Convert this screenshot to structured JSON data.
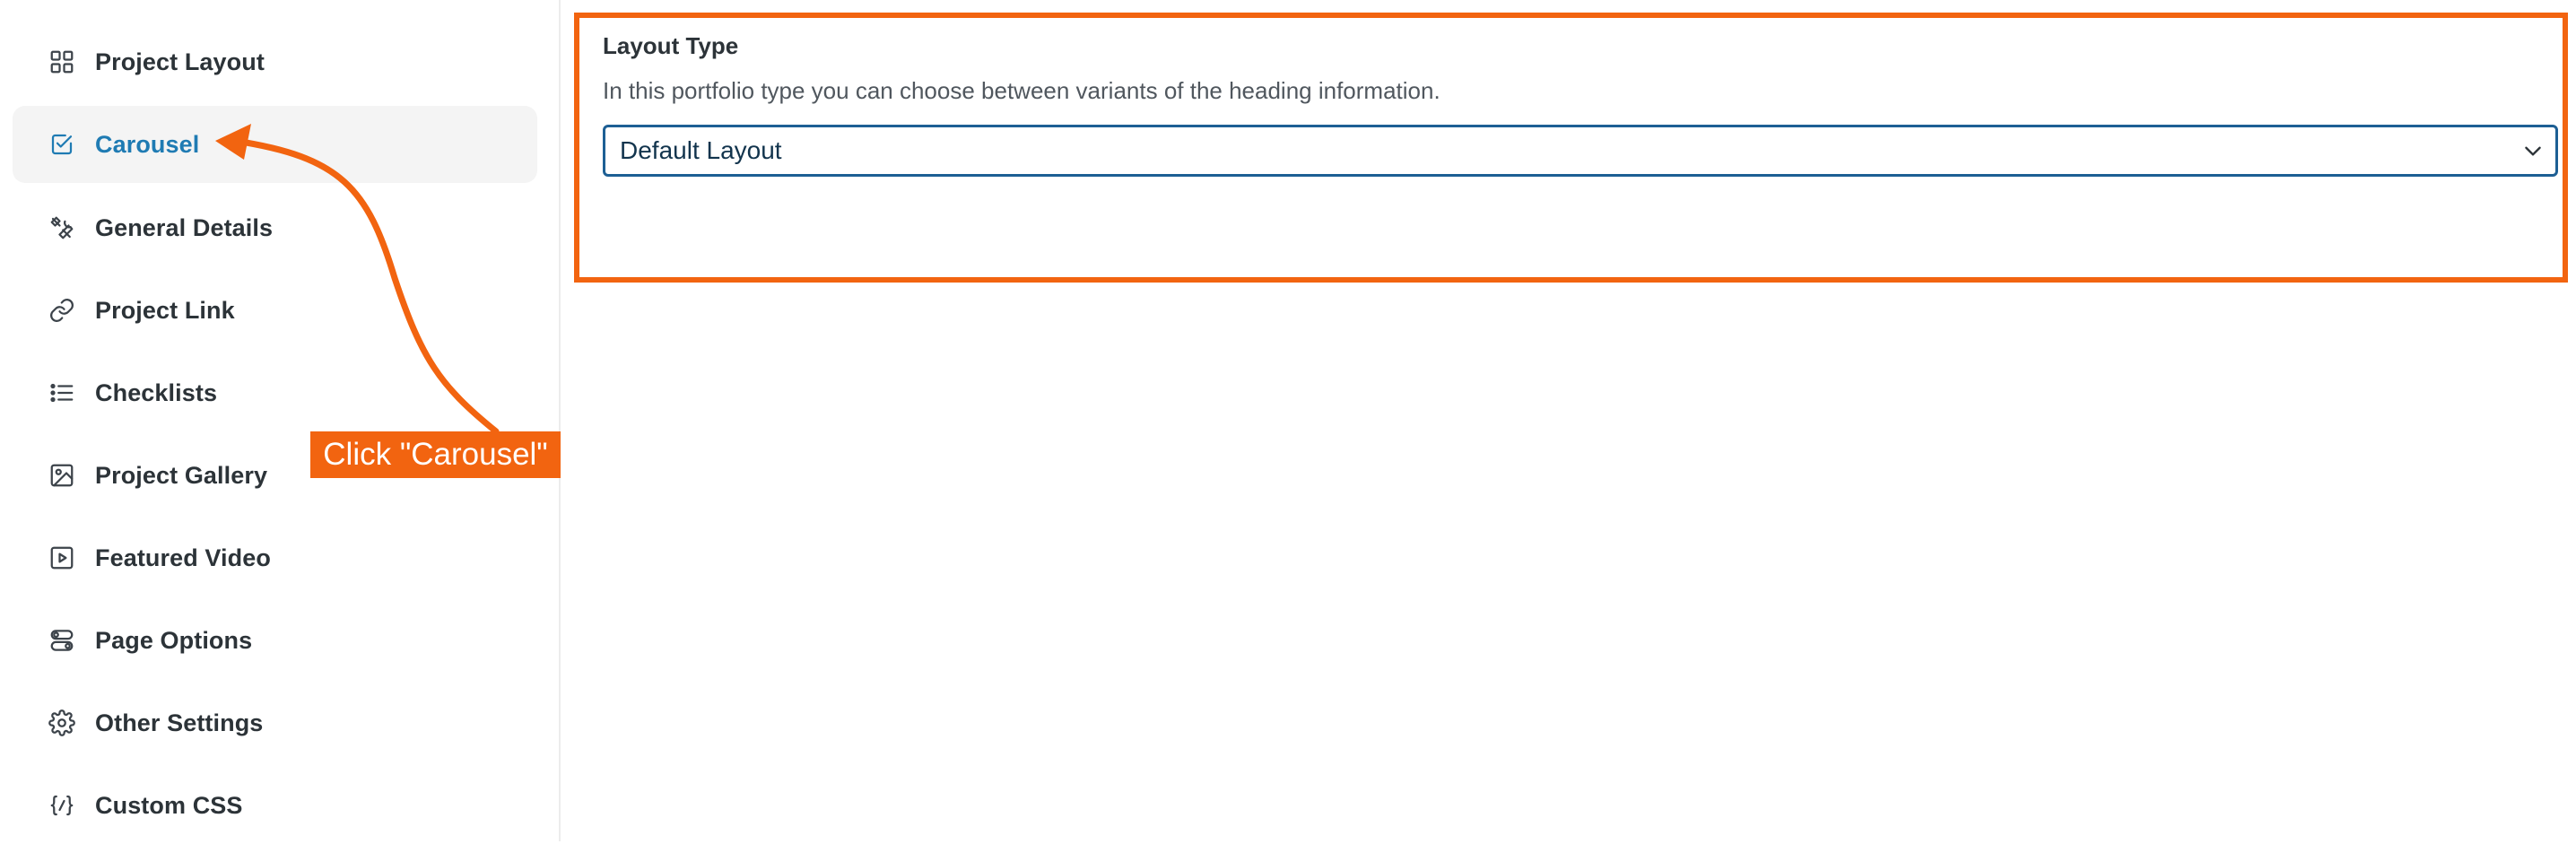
{
  "sidebar": {
    "items": [
      {
        "label": "Project Layout",
        "icon": "grid-icon"
      },
      {
        "label": "Carousel",
        "icon": "checkbox-icon"
      },
      {
        "label": "General Details",
        "icon": "tools-icon"
      },
      {
        "label": "Project Link",
        "icon": "link-icon"
      },
      {
        "label": "Checklists",
        "icon": "list-icon"
      },
      {
        "label": "Project Gallery",
        "icon": "image-icon"
      },
      {
        "label": "Featured Video",
        "icon": "video-icon"
      },
      {
        "label": "Page Options",
        "icon": "toggles-icon"
      },
      {
        "label": "Other Settings",
        "icon": "gear-icon"
      },
      {
        "label": "Custom CSS",
        "icon": "code-icon"
      }
    ],
    "active_item": "Carousel"
  },
  "main": {
    "field_title": "Layout Type",
    "field_description": "In this portfolio type you can choose between variants of the heading information.",
    "select": {
      "value": "Default Layout"
    }
  },
  "annotation": {
    "label": "Click \"Carousel\""
  },
  "colors": {
    "accent": "#f26410",
    "active_link": "#1f7bb3",
    "select_border": "#1d5f94"
  }
}
